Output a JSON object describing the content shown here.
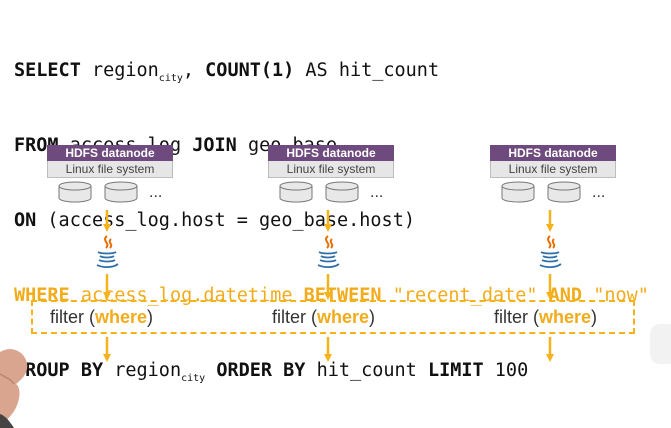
{
  "sql": {
    "l1_select": "SELECT",
    "l1_region": "region",
    "l1_city": "city",
    "l1_comma": ",",
    "l1_count": "COUNT(1)",
    "l1_as": "AS hit_count",
    "l2_from": "FROM",
    "l2_table": "access_log",
    "l2_join": "JOIN",
    "l2_geo": "geo_base",
    "l3_on": "ON",
    "l3_cond": "(access_log.host = geo_base.host)",
    "l4_where": "WHERE",
    "l4_field": "access_log.datetime",
    "l4_between": "BETWEEN",
    "l4_recent": "\"recent_date\"",
    "l4_and": "AND",
    "l4_now": "\"now\"",
    "l5_group": "GROUP BY",
    "l5_region": "region",
    "l5_city": "city",
    "l5_order": "ORDER BY",
    "l5_hit": "hit_count",
    "l5_limit": "LIMIT",
    "l5_num": "100"
  },
  "nodes": [
    {
      "hdfs": "HDFS datanode",
      "lfs": "Linux file system",
      "more": "..."
    },
    {
      "hdfs": "HDFS datanode",
      "lfs": "Linux file system",
      "more": "..."
    },
    {
      "hdfs": "HDFS datanode",
      "lfs": "Linux file system",
      "more": "..."
    }
  ],
  "filters": [
    {
      "prefix": "filter (",
      "keyword": "where",
      "suffix": ")"
    },
    {
      "prefix": "filter (",
      "keyword": "where",
      "suffix": ")"
    },
    {
      "prefix": "filter (",
      "keyword": "where",
      "suffix": ")"
    }
  ],
  "colors": {
    "accent": "#f5b21a",
    "hdfs_header": "#6f4a7e",
    "java_red": "#e76f00",
    "java_blue": "#2f6fa8"
  },
  "icons": [
    "java-coffee-icon",
    "disk-icon",
    "down-arrow-icon"
  ]
}
